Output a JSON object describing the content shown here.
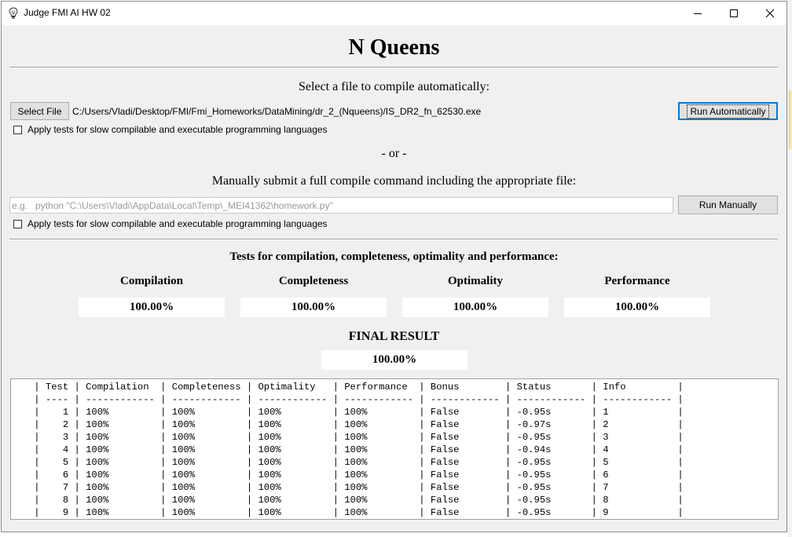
{
  "window": {
    "title": "Judge FMI AI HW 02"
  },
  "page_title": "N Queens",
  "auto": {
    "prompt": "Select a file to compile automatically:",
    "select_file_label": "Select File",
    "path": "C:/Users/Vladi/Desktop/FMI/Fmi_Homeworks/DataMining/dr_2_(Nqueens)/IS_DR2_fn_62530.exe",
    "run_label": "Run Automatically",
    "slow_label": "Apply tests for slow compilable and executable programming languages"
  },
  "or_text": "- or -",
  "manual": {
    "prompt": "Manually submit a full compile command including the appropriate file:",
    "placeholder": "e.g.   python \"C:\\Users\\Vladi\\AppData\\Local\\Temp\\_MEI41362\\homework.py\"",
    "run_label": "Run Manually",
    "slow_label": "Apply tests for slow compilable and executable programming languages"
  },
  "tests": {
    "heading": "Tests for compilation, completeness, optimality and performance:",
    "categories": [
      {
        "name": "Compilation",
        "score": "100.00%"
      },
      {
        "name": "Completeness",
        "score": "100.00%"
      },
      {
        "name": "Optimality",
        "score": "100.00%"
      },
      {
        "name": "Performance",
        "score": "100.00%"
      }
    ],
    "final_label": "FINAL RESULT",
    "final_score": "100.00%"
  },
  "results_table": {
    "lines": [
      "    | Test | Compilation  | Completeness | Optimality   | Performance  | Bonus        | Status       | Info         |",
      "    | ---- | ------------ | ------------ | ------------ | ------------ | ------------ | ------------ | ------------ |",
      "    |    1 | 100%         | 100%         | 100%         | 100%         | False        | -0.95s       | 1            |",
      "    |    2 | 100%         | 100%         | 100%         | 100%         | False        | -0.97s       | 2            |",
      "    |    3 | 100%         | 100%         | 100%         | 100%         | False        | -0.95s       | 3            |",
      "    |    4 | 100%         | 100%         | 100%         | 100%         | False        | -0.94s       | 4            |",
      "    |    5 | 100%         | 100%         | 100%         | 100%         | False        | -0.95s       | 5            |",
      "    |    6 | 100%         | 100%         | 100%         | 100%         | False        | -0.95s       | 6            |",
      "    |    7 | 100%         | 100%         | 100%         | 100%         | False        | -0.95s       | 7            |",
      "    |    8 | 100%         | 100%         | 100%         | 100%         | False        | -0.95s       | 8            |",
      "    |    9 | 100%         | 100%         | 100%         | 100%         | False        | -0.95s       | 9            |"
    ]
  },
  "icons": {
    "app": "lightbulb-icon",
    "minimize": "minimize-icon",
    "maximize": "maximize-icon",
    "close": "close-icon"
  },
  "colors": {
    "window_bg": "#f0f0f0",
    "focus_border": "#0078d7"
  }
}
